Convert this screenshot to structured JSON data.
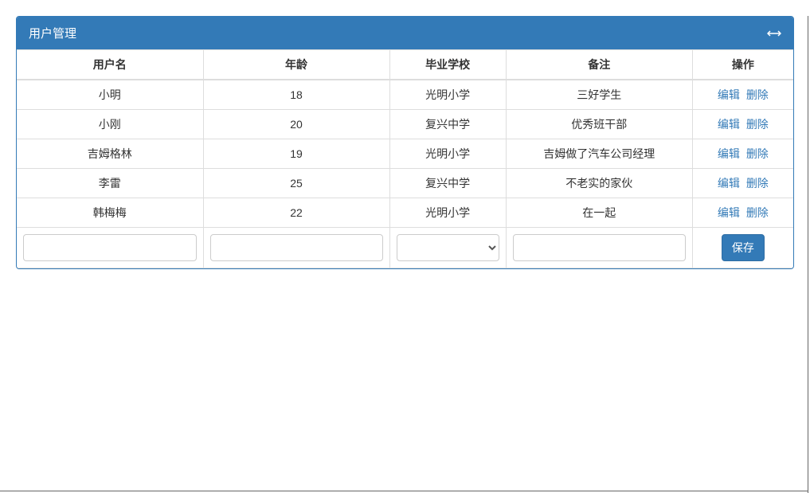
{
  "panel": {
    "title": "用户管理"
  },
  "table": {
    "headers": {
      "name": "用户名",
      "age": "年龄",
      "school": "毕业学校",
      "remark": "备注",
      "ops": "操作"
    },
    "rows": [
      {
        "name": "小明",
        "age": "18",
        "school": "光明小学",
        "remark": "三好学生"
      },
      {
        "name": "小刚",
        "age": "20",
        "school": "复兴中学",
        "remark": "优秀班干部"
      },
      {
        "name": "吉姆格林",
        "age": "19",
        "school": "光明小学",
        "remark": "吉姆做了汽车公司经理"
      },
      {
        "name": "李雷",
        "age": "25",
        "school": "复兴中学",
        "remark": "不老实的家伙"
      },
      {
        "name": "韩梅梅",
        "age": "22",
        "school": "光明小学",
        "remark": "在一起"
      }
    ],
    "actions": {
      "edit": "编辑",
      "delete": "删除"
    },
    "inputRow": {
      "name": "",
      "age": "",
      "school": "",
      "remark": "",
      "saveLabel": "保存"
    }
  }
}
